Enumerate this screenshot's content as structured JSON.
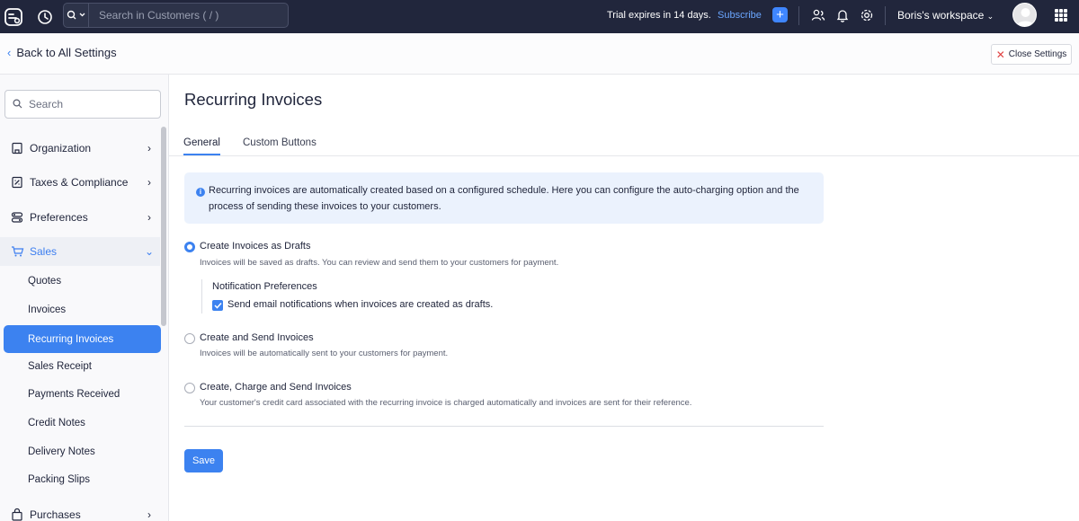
{
  "topbar": {
    "search_placeholder": "Search in Customers ( / )",
    "trial_text": "Trial expires in 14 days.",
    "subscribe_label": "Subscribe",
    "plus_label": "+",
    "workspace_label": "Boris's workspace"
  },
  "subheader": {
    "back_label": "Back to All Settings",
    "close_label": "Close Settings"
  },
  "sidebar": {
    "search_placeholder": "Search",
    "items": [
      {
        "label": "Organization",
        "icon": "organization-icon"
      },
      {
        "label": "Taxes & Compliance",
        "icon": "taxes-icon"
      },
      {
        "label": "Preferences",
        "icon": "preferences-icon"
      },
      {
        "label": "Sales",
        "icon": "cart-icon"
      },
      {
        "label": "Purchases",
        "icon": "bag-icon"
      }
    ],
    "sales_subitems": [
      "Quotes",
      "Invoices",
      "Recurring Invoices",
      "Sales Receipt",
      "Payments Received",
      "Credit Notes",
      "Delivery Notes",
      "Packing Slips"
    ],
    "selected": "Recurring Invoices"
  },
  "main": {
    "title": "Recurring Invoices",
    "tabs": [
      {
        "label": "General",
        "active": true
      },
      {
        "label": "Custom Buttons",
        "active": false
      }
    ],
    "info_text": "Recurring invoices are automatically created based on a configured schedule. Here you can configure the auto-charging option and the process of sending these invoices to your customers.",
    "options": [
      {
        "title": "Create Invoices as Drafts",
        "desc": "Invoices will be saved as drafts. You can review and send them to your customers for payment.",
        "selected": true
      },
      {
        "title": "Create and Send Invoices",
        "desc": "Invoices will be automatically sent to your customers for payment.",
        "selected": false
      },
      {
        "title": "Create, Charge and Send Invoices",
        "desc": "Your customer's credit card associated with the recurring invoice is charged automatically and invoices are sent for their reference.",
        "selected": false
      }
    ],
    "notification": {
      "title": "Notification Preferences",
      "checkbox_label": "Send email notifications when invoices are created as drafts.",
      "checked": true
    },
    "save_label": "Save"
  },
  "colors": {
    "accent": "#3c82f0",
    "topbar": "#21263c",
    "info_bg": "#ebf2fd"
  }
}
